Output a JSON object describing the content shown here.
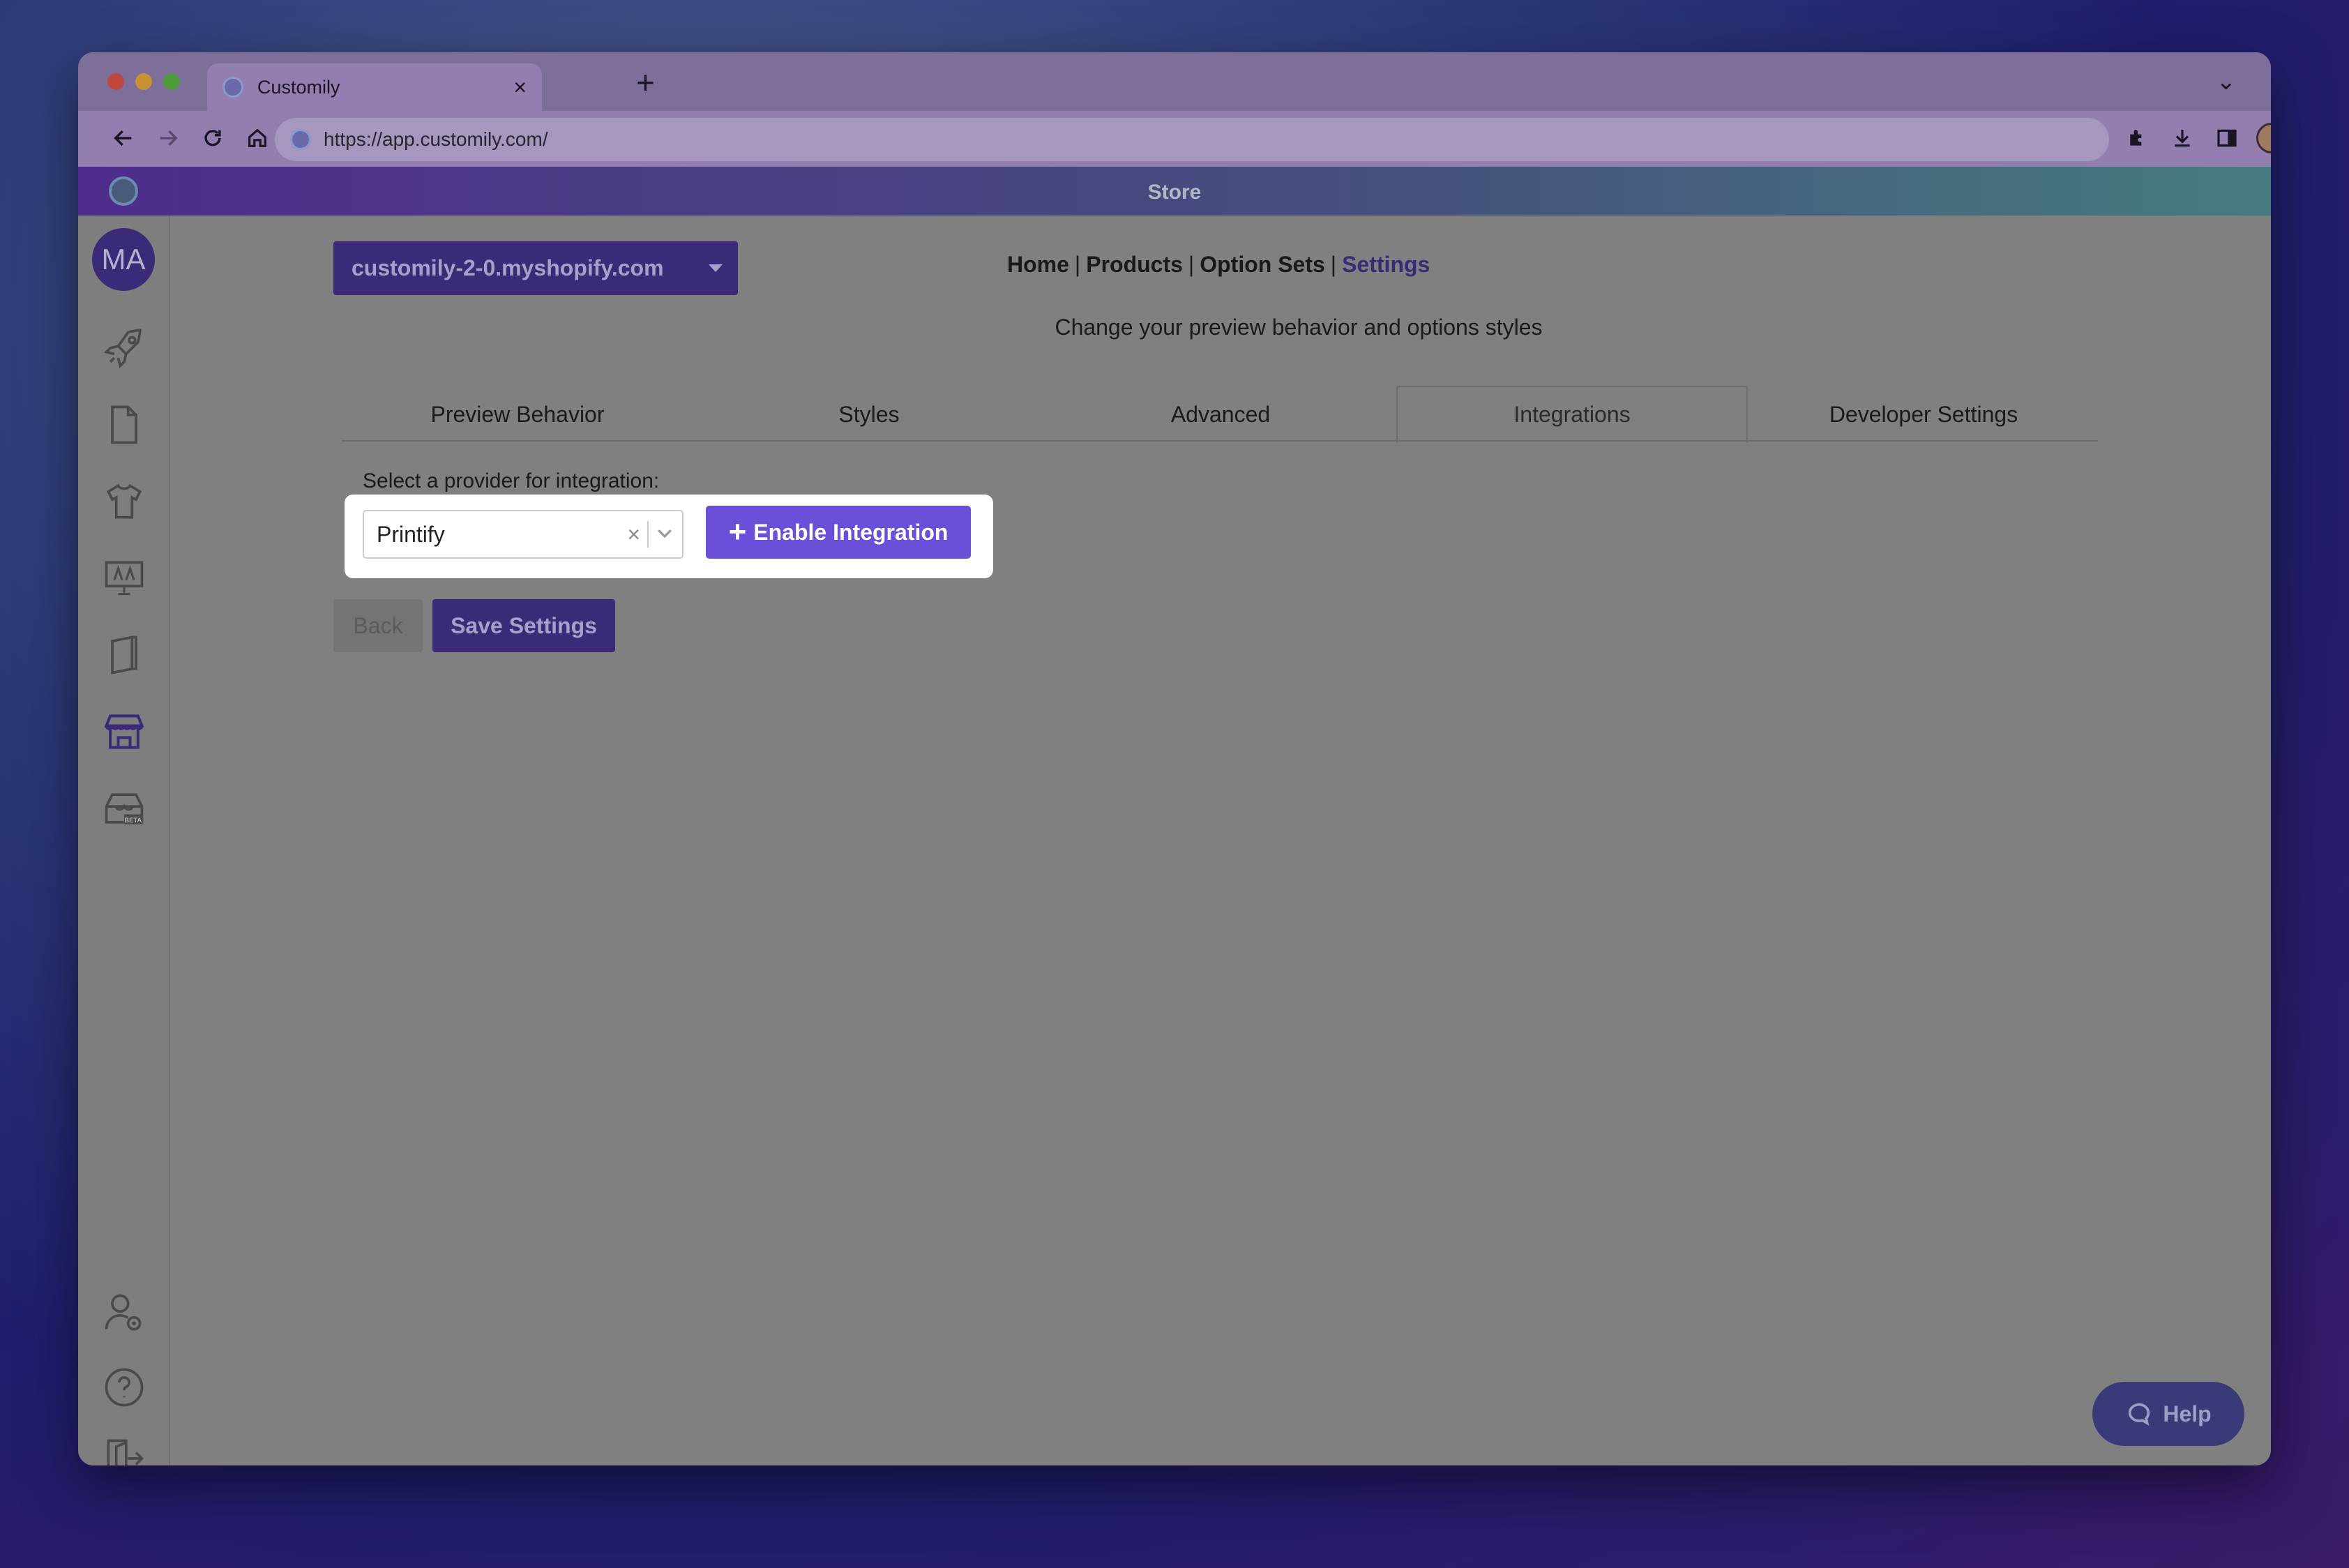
{
  "browser": {
    "tab_title": "Customily",
    "tab_close": "×",
    "new_tab": "+",
    "url": "https://app.customily.com/"
  },
  "app": {
    "header_title": "Store",
    "avatar_initials": "MA"
  },
  "store_selector": {
    "value": "customily-2-0.myshopify.com"
  },
  "topnav": {
    "items": [
      "Home",
      "Products",
      "Option Sets",
      "Settings"
    ],
    "separator": "|",
    "active": "Settings"
  },
  "page": {
    "subtitle": "Change your preview behavior and options styles"
  },
  "tabs": [
    {
      "label": "Preview Behavior"
    },
    {
      "label": "Styles"
    },
    {
      "label": "Advanced"
    },
    {
      "label": "Integrations"
    },
    {
      "label": "Developer Settings"
    }
  ],
  "active_tab": "Integrations",
  "integration": {
    "label": "Select a provider for integration:",
    "selected_provider": "Printify",
    "clear_symbol": "×",
    "enable_plus": "+",
    "enable_label": "Enable Integration"
  },
  "actions": {
    "back_label": "Back",
    "save_label": "Save Settings"
  },
  "help": {
    "label": "Help"
  },
  "sidebar": {
    "icons": [
      "rocket-icon",
      "document-icon",
      "tshirt-icon",
      "monitor-icon",
      "book-icon",
      "store-icon",
      "store-beta-icon",
      "user-settings-icon",
      "help-circle-icon",
      "logout-icon"
    ],
    "beta_badge": "BETA"
  },
  "colors": {
    "brand_purple": "#3a2a78",
    "enable_button": "#6b4fd8",
    "overlay_gray": "#808080"
  }
}
